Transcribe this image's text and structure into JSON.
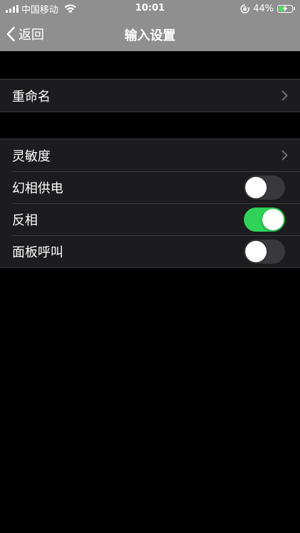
{
  "status_bar": {
    "carrier": "中国移动",
    "time": "10:01",
    "battery_percent": "44%",
    "battery_level": 0.44,
    "icons": [
      "signal-icon",
      "wifi-icon",
      "rotation-lock-icon",
      "battery-charging-icon"
    ]
  },
  "nav": {
    "back_label": "返回",
    "title": "输入设置"
  },
  "groups": [
    {
      "rows": [
        {
          "label": "重命名",
          "type": "disclosure"
        }
      ]
    },
    {
      "rows": [
        {
          "label": "灵敏度",
          "type": "disclosure"
        },
        {
          "label": "幻相供电",
          "type": "toggle",
          "on": false
        },
        {
          "label": "反相",
          "type": "toggle",
          "on": true
        },
        {
          "label": "面板呼叫",
          "type": "toggle",
          "on": false
        }
      ]
    }
  ],
  "colors": {
    "nav_background": "#8f8f8f",
    "page_background": "#000000",
    "cell_background": "#1c1c1e",
    "toggle_on": "#30d158",
    "toggle_off": "#39393d"
  }
}
